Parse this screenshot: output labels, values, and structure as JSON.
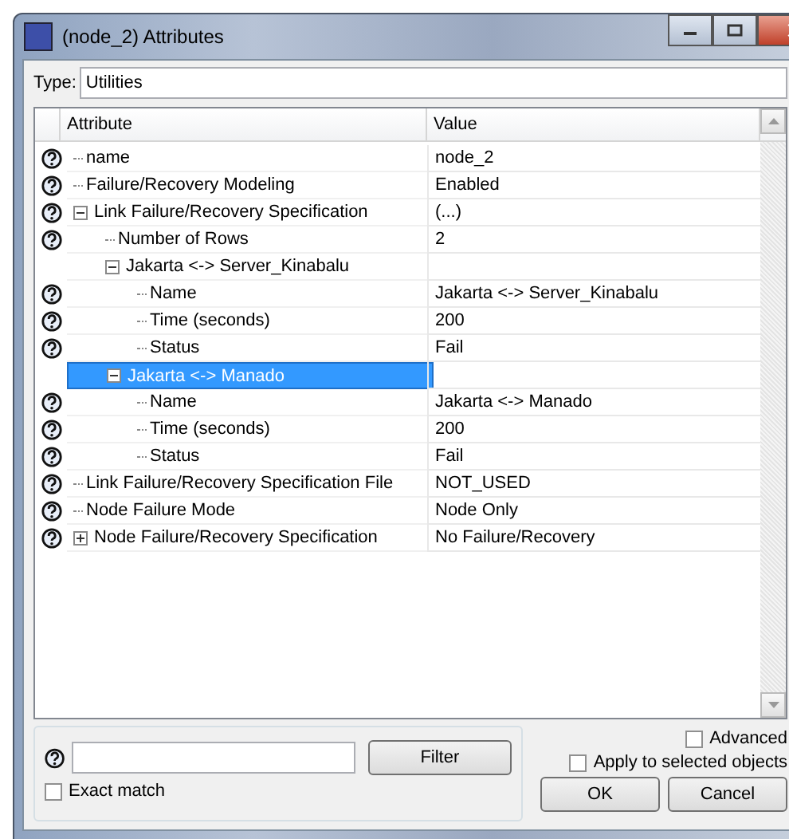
{
  "window": {
    "title": "(node_2) Attributes"
  },
  "type_field": {
    "label": "Type:",
    "value": "Utilities"
  },
  "table": {
    "columns": [
      "Attribute",
      "Value"
    ],
    "rows": [
      {
        "attribute": "name",
        "value": "node_2",
        "help": true,
        "selected": false
      },
      {
        "attribute": "Failure/Recovery Modeling",
        "value": "Enabled",
        "help": true,
        "selected": false
      },
      {
        "attribute": "Link Failure/Recovery Specification",
        "value": "(...)",
        "help": true,
        "selected": false,
        "expanded": true,
        "children": [
          {
            "attribute": "Number of Rows",
            "value": "2",
            "help": true,
            "selected": false
          },
          {
            "attribute": "Jakarta <-> Server_Kinabalu",
            "help": false,
            "selected": false,
            "expanded": true,
            "children": [
              {
                "attribute": "Name",
                "value": "Jakarta <-> Server_Kinabalu",
                "help": true,
                "selected": false
              },
              {
                "attribute": "Time (seconds)",
                "value": "200",
                "help": true,
                "selected": false
              },
              {
                "attribute": "Status",
                "value": "Fail",
                "help": true,
                "selected": false
              }
            ]
          },
          {
            "attribute": "Jakarta <-> Manado",
            "help": false,
            "selected": true,
            "expanded": true,
            "children": [
              {
                "attribute": "Name",
                "value": "Jakarta <-> Manado",
                "help": true,
                "selected": false
              },
              {
                "attribute": "Time (seconds)",
                "value": "200",
                "help": true,
                "selected": false
              },
              {
                "attribute": "Status",
                "value": "Fail",
                "help": true,
                "selected": false
              }
            ]
          }
        ]
      },
      {
        "attribute": "Link Failure/Recovery Specification File",
        "value": "NOT_USED",
        "help": true,
        "selected": false
      },
      {
        "attribute": "Node Failure Mode",
        "value": "Node Only",
        "help": true,
        "selected": false
      },
      {
        "attribute": "Node Failure/Recovery Specification",
        "value": "No Failure/Recovery",
        "help": true,
        "selected": false,
        "expanded": false
      }
    ]
  },
  "filter": {
    "button": "Filter",
    "exact_match": {
      "label": "Exact match",
      "checked": false
    }
  },
  "advanced": {
    "label": "Advanced",
    "checked": false
  },
  "apply_selected": {
    "label": "Apply to selected objects",
    "checked": false
  },
  "buttons": [
    "OK",
    "Cancel"
  ]
}
